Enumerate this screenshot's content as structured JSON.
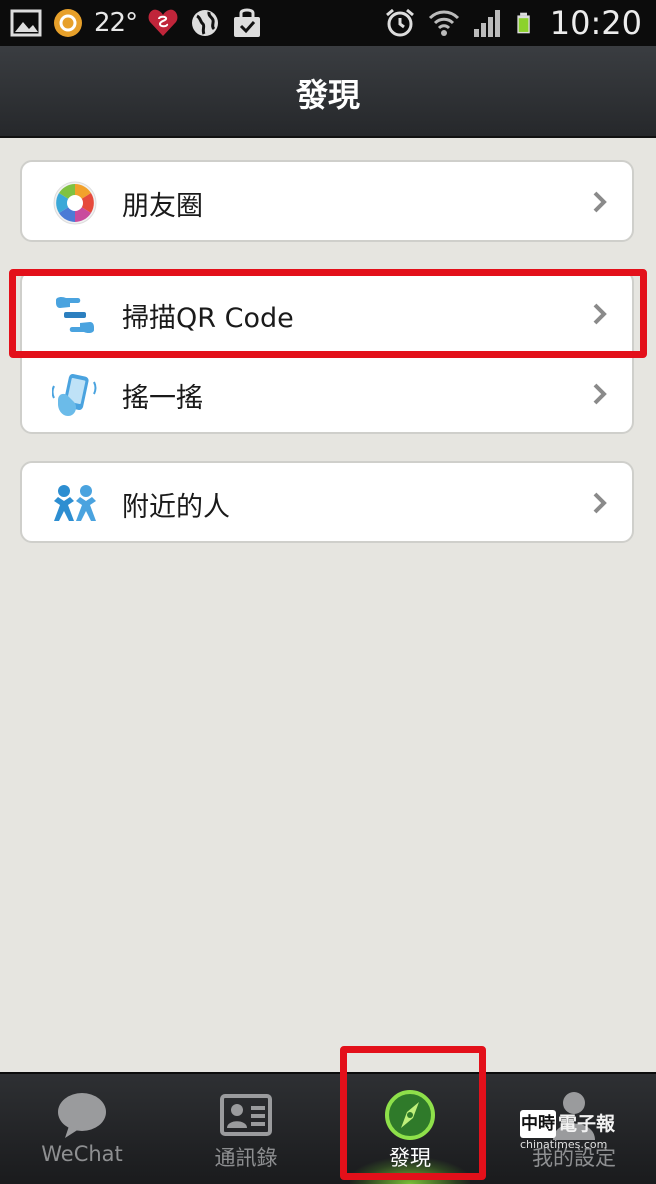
{
  "status_bar": {
    "temperature": "22°",
    "time": "10:20"
  },
  "title_bar": {
    "title": "發現"
  },
  "menu": {
    "groups": [
      {
        "items": [
          {
            "label": "朋友圈",
            "icon": "moments-icon"
          }
        ]
      },
      {
        "items": [
          {
            "label": "掃描QR Code",
            "icon": "scan-qr-icon"
          },
          {
            "label": "搖一搖",
            "icon": "shake-icon"
          }
        ]
      },
      {
        "items": [
          {
            "label": "附近的人",
            "icon": "people-nearby-icon"
          }
        ]
      }
    ]
  },
  "tab_bar": {
    "tabs": [
      {
        "label": "WeChat",
        "icon": "chat-bubble-icon",
        "active": false
      },
      {
        "label": "通訊錄",
        "icon": "contacts-card-icon",
        "active": false
      },
      {
        "label": "發現",
        "icon": "compass-icon",
        "active": true
      },
      {
        "label": "我的設定",
        "icon": "person-icon",
        "active": false
      }
    ]
  },
  "watermark": {
    "line1": "中時",
    "line2": "電子報",
    "url": "chinatimes.com"
  },
  "colors": {
    "highlight": "#e3101a",
    "background": "#e6e5e0",
    "active_glow": "#8cdc3c"
  }
}
